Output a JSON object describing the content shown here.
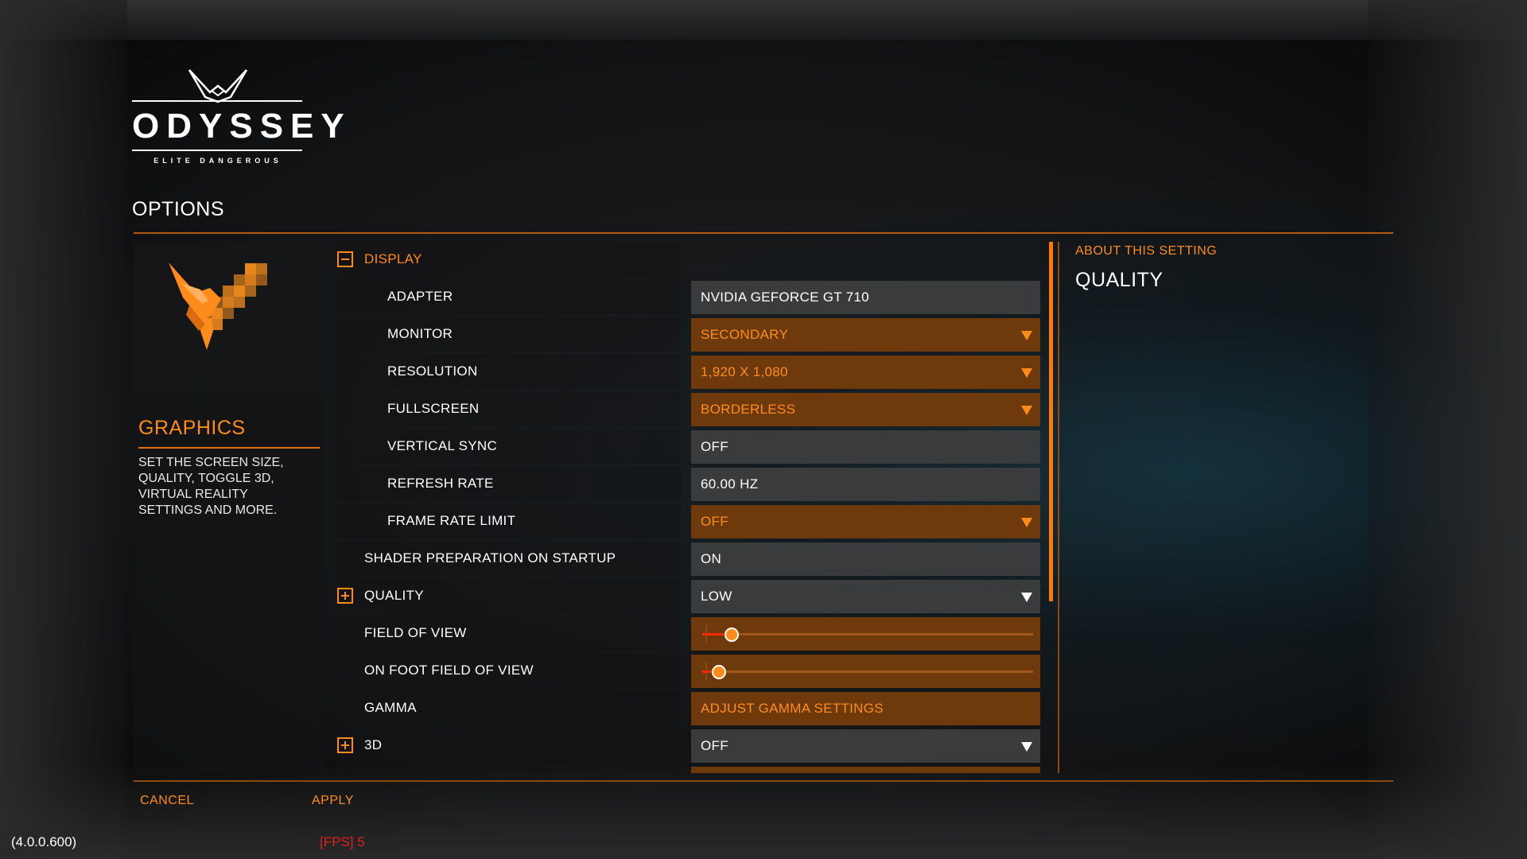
{
  "logo": {
    "word": "ODYSSEY",
    "sub": "ELITE DANGEROUS"
  },
  "page": {
    "title": "OPTIONS"
  },
  "category": {
    "title": "GRAPHICS",
    "description": "SET THE SCREEN SIZE, QUALITY, TOGGLE 3D, VIRTUAL REALITY SETTINGS AND MORE."
  },
  "settings": {
    "display_header": "DISPLAY",
    "adapter": {
      "label": "ADAPTER",
      "value": "NVIDIA GEFORCE GT 710"
    },
    "monitor": {
      "label": "MONITOR",
      "value": "SECONDARY"
    },
    "resolution": {
      "label": "RESOLUTION",
      "value": "1,920 X 1,080"
    },
    "fullscreen": {
      "label": "FULLSCREEN",
      "value": "BORDERLESS"
    },
    "vsync": {
      "label": "VERTICAL SYNC",
      "value": "OFF"
    },
    "refresh": {
      "label": "REFRESH RATE",
      "value": "60.00 HZ"
    },
    "frame_limit": {
      "label": "FRAME RATE LIMIT",
      "value": "OFF"
    },
    "shader": {
      "label": "SHADER PREPARATION ON STARTUP",
      "value": "ON"
    },
    "quality": {
      "label": "QUALITY",
      "value": "LOW"
    },
    "fov": {
      "label": "FIELD OF VIEW",
      "level": 0.09
    },
    "onfoot_fov": {
      "label": "ON FOOT FIELD OF VIEW",
      "level": 0.05
    },
    "gamma": {
      "label": "GAMMA",
      "value": "ADJUST GAMMA SETTINGS"
    },
    "three_d": {
      "label": "3D",
      "value": "OFF"
    }
  },
  "about": {
    "heading": "ABOUT THIS SETTING",
    "title": "QUALITY"
  },
  "footer": {
    "cancel": "CANCEL",
    "apply": "APPLY",
    "version": "(4.0.0.600)",
    "fps": "[FPS] 5"
  },
  "colors": {
    "accent": "#ff8c1a",
    "accent_dark": "#6e3a0c",
    "control_grey": "#3a3b3d",
    "fps_red": "#e0201a"
  }
}
